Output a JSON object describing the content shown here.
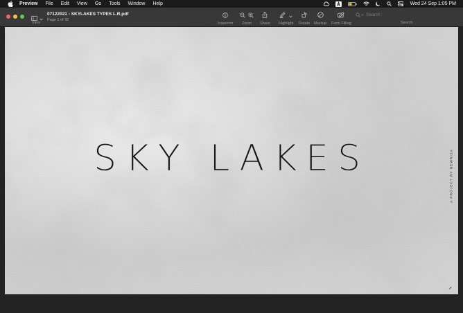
{
  "menubar": {
    "items": [
      "Preview",
      "File",
      "Edit",
      "View",
      "Go",
      "Tools",
      "Window",
      "Help"
    ],
    "clock": "Wed 24 Sep  1:05 PM"
  },
  "window": {
    "view_label": "View",
    "doc_title": "07122021 - SKYLAKES TYPES L.R.pdf",
    "page_indicator": "Page 1 of 32",
    "toolbar": {
      "inspector": "Inspector",
      "zoom": "Zoom",
      "share": "Share",
      "highlight": "Highlight",
      "rotate": "Rotate",
      "markup": "Markup",
      "form_filling": "Form Filling"
    },
    "search": {
      "placeholder": "Search",
      "label": "Search"
    }
  },
  "document": {
    "brand": "SKY LAKES",
    "side_tag": "A PROJECT BY NEWRIZA"
  },
  "colors": {
    "menubar_bg": "#1b1b1b",
    "toolbar_bg": "#383838",
    "close": "#ed6a5e",
    "minimize": "#f5bf4f",
    "zoom": "#61c554",
    "page_bg": "#d9d9d9",
    "battery": "#f5c542"
  }
}
